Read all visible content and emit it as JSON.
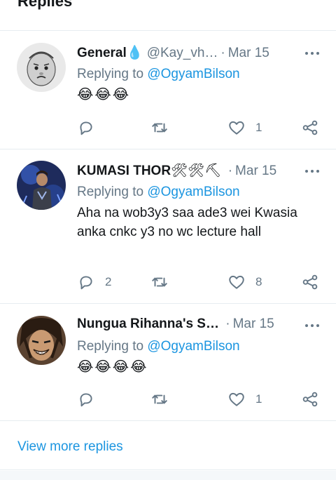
{
  "header": {
    "title": "Replies"
  },
  "replies": [
    {
      "display_name": "General",
      "name_suffix": "💧",
      "handle": "@Kay_vh…",
      "separator": "·",
      "date": "Mar 15",
      "replying_prefix": "Replying to",
      "replying_to": "@OgyamBilson",
      "text": "😂😂😂",
      "reply_count": "",
      "retweet_count": "",
      "like_count": "1"
    },
    {
      "display_name": "KUMASI THOR",
      "name_suffix": "🛠🛠⛏",
      "handle": "",
      "separator": "·",
      "date": "Mar 15",
      "replying_prefix": "Replying to",
      "replying_to": "@OgyamBilson",
      "text": "Aha na wob3y3 saa ade3 wei Kwasia anka cnkc y3 no wc lecture hall",
      "reply_count": "2",
      "retweet_count": "",
      "like_count": "8"
    },
    {
      "display_name": "Nungua Rihanna's S…",
      "name_suffix": "",
      "handle": "",
      "separator": "·",
      "date": "Mar 15",
      "replying_prefix": "Replying to",
      "replying_to": "@OgyamBilson",
      "text": "😂😂😂😂",
      "reply_count": "",
      "retweet_count": "",
      "like_count": "1"
    }
  ],
  "footer": {
    "view_more": "View more replies"
  },
  "colors": {
    "link": "#1b95e0",
    "muted": "#657786",
    "text": "#14171a",
    "border": "#e6ecf0"
  },
  "icons": [
    "reply-icon",
    "retweet-icon",
    "like-icon",
    "share-icon",
    "more-options-icon"
  ]
}
